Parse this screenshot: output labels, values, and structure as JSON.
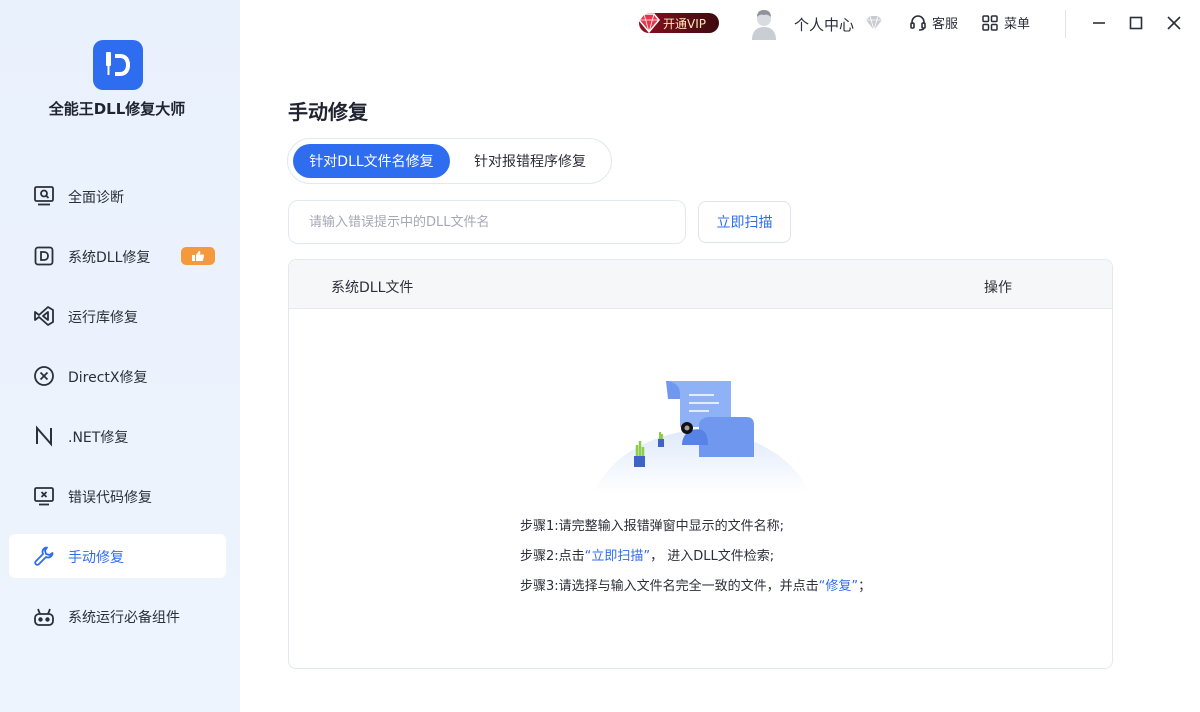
{
  "app": {
    "title": "全能王DLL修复大师"
  },
  "sidebar": {
    "items": [
      {
        "label": "全面诊断",
        "icon": "diagnose-icon"
      },
      {
        "label": "系统DLL修复",
        "icon": "dll-icon"
      },
      {
        "label": "运行库修复",
        "icon": "runtime-icon"
      },
      {
        "label": "DirectX修复",
        "icon": "directx-icon"
      },
      {
        "label": ".NET修复",
        "icon": "dotnet-icon"
      },
      {
        "label": "错误代码修复",
        "icon": "error-code-icon"
      },
      {
        "label": "手动修复",
        "icon": "wrench-icon",
        "active": true
      },
      {
        "label": "系统运行必备组件",
        "icon": "components-icon"
      }
    ]
  },
  "topbar": {
    "vip_label": "开通VIP",
    "user_center": "个人中心",
    "service": "客服",
    "menu": "菜单"
  },
  "main": {
    "title": "手动修复",
    "tabs": [
      {
        "label": "针对DLL文件名修复",
        "active": true
      },
      {
        "label": "针对报错程序修复",
        "active": false
      }
    ],
    "search": {
      "placeholder": "请输入错误提示中的DLL文件名",
      "value": ""
    },
    "scan_button": "立即扫描",
    "table": {
      "columns": [
        "系统DLL文件",
        "操作"
      ]
    },
    "steps": {
      "step1": "步骤1:请完整输入报错弹窗中显示的文件名称;",
      "step2_prefix": "步骤2:点击",
      "step2_link": "“立即扫描”",
      "step2_suffix": "， 进入DLL文件检索;",
      "step3_prefix": "步骤3:请选择与输入文件名完全一致的文件，并点击",
      "step3_link": "“修复”",
      "step3_suffix": "；"
    }
  },
  "colors": {
    "accent": "#2f6df0",
    "sidebar_bg": "#e9f1fd",
    "badge": "#f59a3c"
  }
}
